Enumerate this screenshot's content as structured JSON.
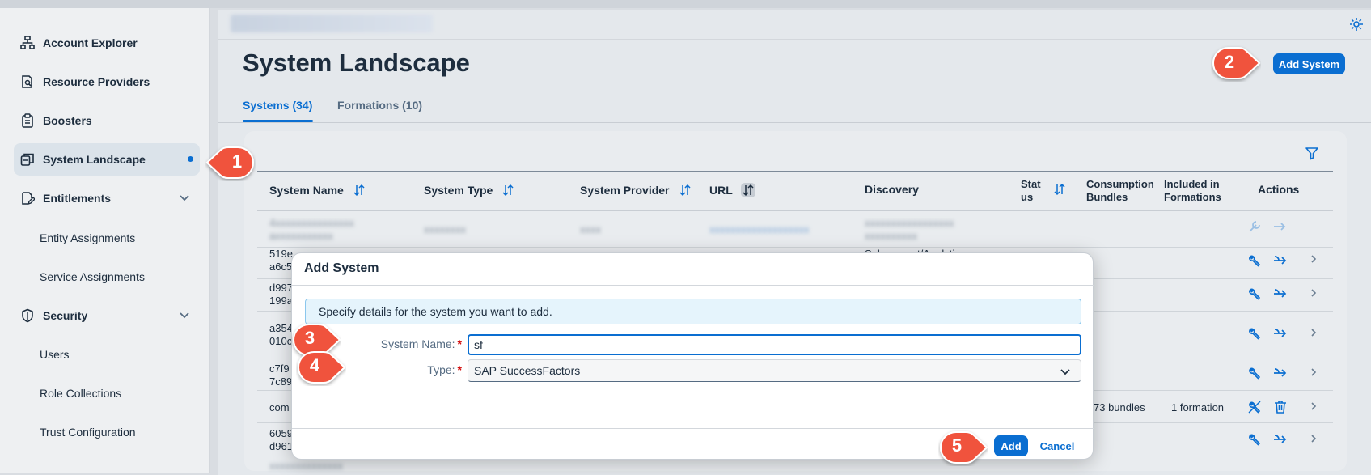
{
  "sidebar": {
    "items": [
      {
        "label": "Account Explorer",
        "icon": "hierarchy-icon"
      },
      {
        "label": "Resource Providers",
        "icon": "document-search-icon"
      },
      {
        "label": "Boosters",
        "icon": "clipboard-icon"
      },
      {
        "label": "System Landscape",
        "icon": "systems-icon",
        "selected": true
      },
      {
        "label": "Entitlements",
        "icon": "entitlement-icon",
        "expandable": true
      },
      {
        "label": "Security",
        "icon": "shield-icon",
        "expandable": true
      }
    ],
    "entitlements_sub": [
      "Entity Assignments",
      "Service Assignments"
    ],
    "security_sub": [
      "Users",
      "Role Collections",
      "Trust Configuration"
    ]
  },
  "page": {
    "title": "System Landscape",
    "add_system": "Add System",
    "tabs": [
      "Systems (34)",
      "Formations (10)"
    ]
  },
  "table": {
    "columns": {
      "name": "System Name",
      "type": "System Type",
      "provider": "System Provider",
      "url": "URL",
      "discovery": "Discovery",
      "status_1": "Stat",
      "status_2": "us",
      "bundles_1": "Consumption",
      "bundles_2": "Bundles",
      "formations_1": "Included in",
      "formations_2": "Formations",
      "actions": "Actions"
    },
    "rows": [
      {
        "name_1": "519e",
        "name_2": "a6c5"
      },
      {
        "name_1": "d997",
        "name_2": "199a"
      },
      {
        "name_1": "a354",
        "name_2": "010c"
      },
      {
        "name_1": "c7f9",
        "name_2": "7c89"
      },
      {
        "name_1": "com",
        "bundles": "73 bundles",
        "formations": "1 formation"
      },
      {
        "name_1": "6059",
        "name_2": "d961"
      }
    ],
    "partial_discovery": "Subaccount/Analytics"
  },
  "dialog": {
    "title": "Add System",
    "info": "Specify details for the system you want to add.",
    "name_label": "System Name:",
    "name_value": "sf",
    "type_label": "Type:",
    "type_value": "SAP SuccessFactors",
    "add": "Add",
    "cancel": "Cancel"
  },
  "callouts": [
    "1",
    "2",
    "3",
    "4",
    "5"
  ],
  "colors": {
    "accent": "#0a6ed1",
    "callout": "#f0533c",
    "required": "#d20a0a"
  }
}
